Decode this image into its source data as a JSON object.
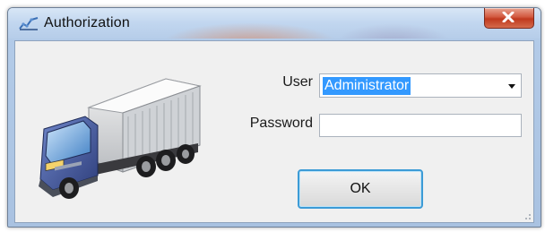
{
  "window": {
    "title": "Authorization",
    "app_icon": "network-chart-icon",
    "close_icon": "close-icon"
  },
  "form": {
    "user_label": "User",
    "user_value": "Administrator",
    "password_label": "Password",
    "password_value": "",
    "ok_label": "OK"
  },
  "decor": {
    "truck_image": "truck-icon",
    "resize_grip": "resize-grip-icon"
  },
  "colors": {
    "selection": "#3399ff",
    "close_button": "#c7432a",
    "ok_focus_border": "#3c9bd6"
  }
}
